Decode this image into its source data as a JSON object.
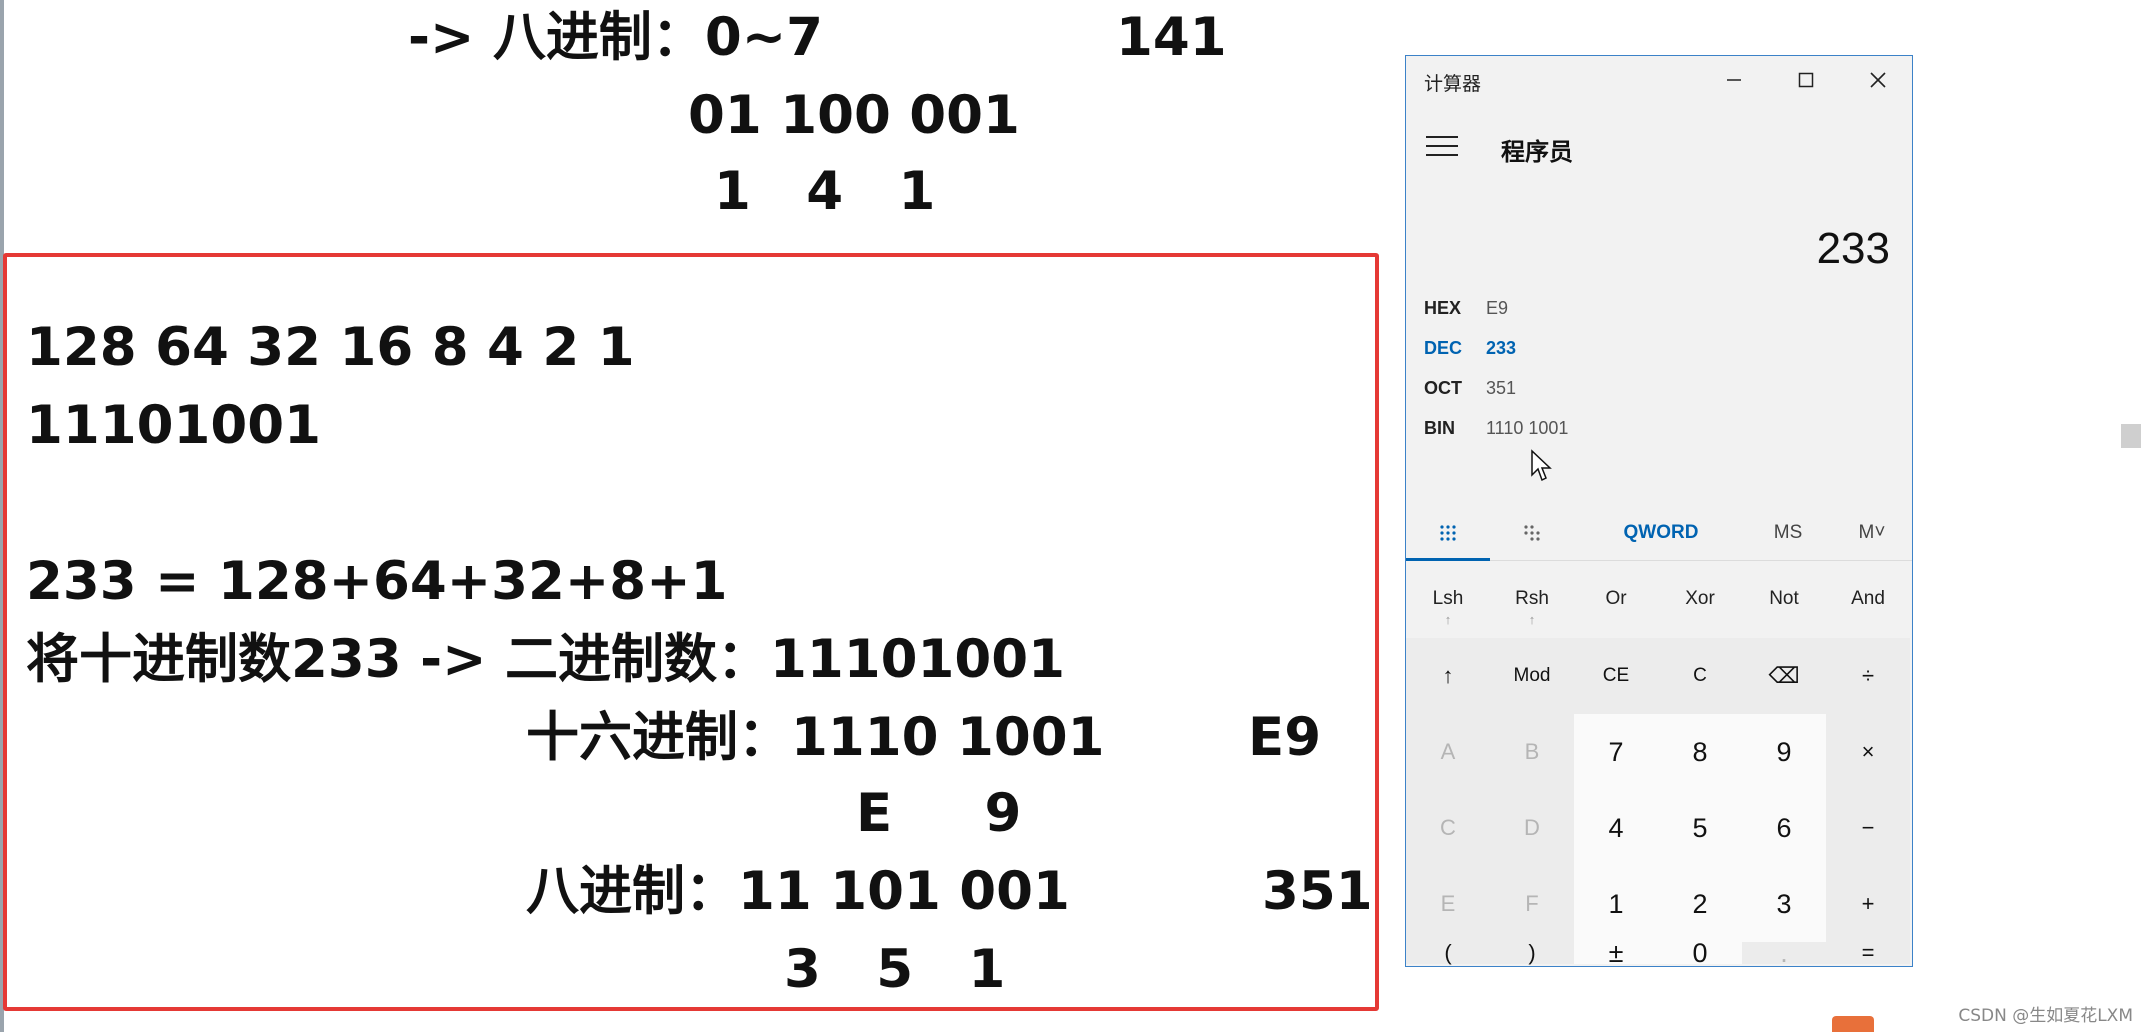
{
  "notes": {
    "top_lines": [
      "-> 八进制：0~7",
      "141",
      "01 100 001",
      "1   4   1"
    ],
    "box_lines": [
      "128 64 32 16 8 4 2 1",
      "11101001",
      "233 = 128+64+32+8+1",
      "将十进制数233 -> 二进制数：11101001",
      "十六进制：1110 1001",
      "E9",
      "E     9",
      "八进制：11 101 001",
      "351",
      "3   5   1"
    ]
  },
  "calculator": {
    "title": "计算器",
    "mode": "程序员",
    "display": "233",
    "radix": [
      {
        "label": "HEX",
        "value": "E9"
      },
      {
        "label": "DEC",
        "value": "233"
      },
      {
        "label": "OCT",
        "value": "351"
      },
      {
        "label": "BIN",
        "value": "1110 1001"
      }
    ],
    "tabs": {
      "word_size": "QWORD",
      "ms": "MS",
      "m": "M˅"
    },
    "bitops": [
      {
        "label": "Lsh",
        "sub": "↑"
      },
      {
        "label": "Rsh",
        "sub": "↑"
      },
      {
        "label": "Or",
        "sub": ""
      },
      {
        "label": "Xor",
        "sub": ""
      },
      {
        "label": "Not",
        "sub": ""
      },
      {
        "label": "And",
        "sub": ""
      }
    ],
    "keys": {
      "row1": [
        "↑",
        "Mod",
        "CE",
        "C",
        "⌫",
        "÷"
      ],
      "row2": [
        "A",
        "B",
        "7",
        "8",
        "9",
        "×"
      ],
      "row3": [
        "C",
        "D",
        "4",
        "5",
        "6",
        "−"
      ],
      "row4": [
        "E",
        "F",
        "1",
        "2",
        "3",
        "+"
      ],
      "row5": [
        "(",
        ")",
        "±",
        "0",
        ".",
        "="
      ]
    }
  },
  "watermark": "CSDN @生如夏花LXM",
  "colors": {
    "accent": "#0063b1",
    "frame": "#e53935"
  }
}
